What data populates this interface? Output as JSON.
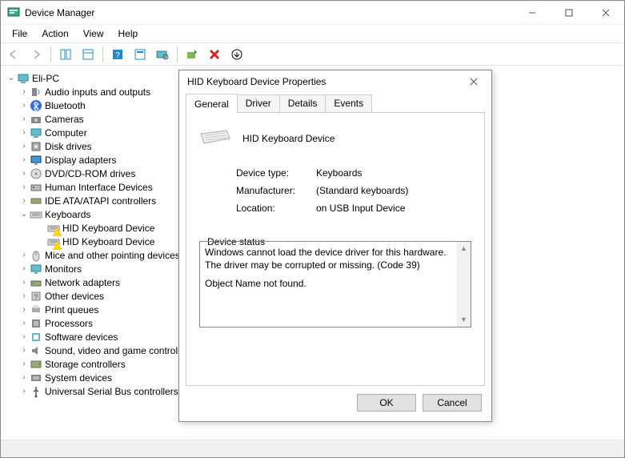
{
  "window": {
    "title": "Device Manager",
    "controls": {
      "min": "–",
      "max": "▢",
      "close": "✕"
    }
  },
  "menubar": [
    "File",
    "Action",
    "View",
    "Help"
  ],
  "toolbar_icons": [
    "back",
    "forward",
    "show-hide",
    "properties",
    "help",
    "refresh-view",
    "scan",
    "update-driver",
    "uninstall",
    "chevmenu"
  ],
  "tree": {
    "root": "Eli-PC",
    "nodes": [
      {
        "label": "Audio inputs and outputs",
        "icon": "audio",
        "expanded": false
      },
      {
        "label": "Bluetooth",
        "icon": "bluetooth",
        "expanded": false
      },
      {
        "label": "Cameras",
        "icon": "camera",
        "expanded": false
      },
      {
        "label": "Computer",
        "icon": "computer",
        "expanded": false
      },
      {
        "label": "Disk drives",
        "icon": "disk",
        "expanded": false
      },
      {
        "label": "Display adapters",
        "icon": "display",
        "expanded": false
      },
      {
        "label": "DVD/CD-ROM drives",
        "icon": "optical",
        "expanded": false
      },
      {
        "label": "Human Interface Devices",
        "icon": "hid",
        "expanded": false
      },
      {
        "label": "IDE ATA/ATAPI controllers",
        "icon": "ide",
        "expanded": false
      },
      {
        "label": "Keyboards",
        "icon": "keyboard",
        "expanded": true,
        "children": [
          {
            "label": "HID Keyboard Device",
            "icon": "keyboard",
            "warn": true
          },
          {
            "label": "HID Keyboard Device",
            "icon": "keyboard",
            "warn": true
          }
        ]
      },
      {
        "label": "Mice and other pointing devices",
        "icon": "mouse",
        "expanded": false
      },
      {
        "label": "Monitors",
        "icon": "monitor",
        "expanded": false
      },
      {
        "label": "Network adapters",
        "icon": "network",
        "expanded": false
      },
      {
        "label": "Other devices",
        "icon": "other",
        "expanded": false
      },
      {
        "label": "Print queues",
        "icon": "printer",
        "expanded": false
      },
      {
        "label": "Processors",
        "icon": "cpu",
        "expanded": false
      },
      {
        "label": "Software devices",
        "icon": "software",
        "expanded": false
      },
      {
        "label": "Sound, video and game controllers",
        "icon": "sound",
        "expanded": false
      },
      {
        "label": "Storage controllers",
        "icon": "storage",
        "expanded": false
      },
      {
        "label": "System devices",
        "icon": "system",
        "expanded": false
      },
      {
        "label": "Universal Serial Bus controllers",
        "icon": "usb",
        "expanded": false
      }
    ]
  },
  "dialog": {
    "title": "HID Keyboard Device Properties",
    "tabs": [
      "General",
      "Driver",
      "Details",
      "Events"
    ],
    "active_tab": "General",
    "device_name": "HID Keyboard Device",
    "props": {
      "device_type_label": "Device type:",
      "device_type_value": "Keyboards",
      "manufacturer_label": "Manufacturer:",
      "manufacturer_value": "(Standard keyboards)",
      "location_label": "Location:",
      "location_value": "on USB Input Device"
    },
    "status_legend": "Device status",
    "status_line1": "Windows cannot load the device driver for this hardware. The driver may be corrupted or missing. (Code 39)",
    "status_line2": "Object Name not found.",
    "buttons": {
      "ok": "OK",
      "cancel": "Cancel"
    }
  }
}
